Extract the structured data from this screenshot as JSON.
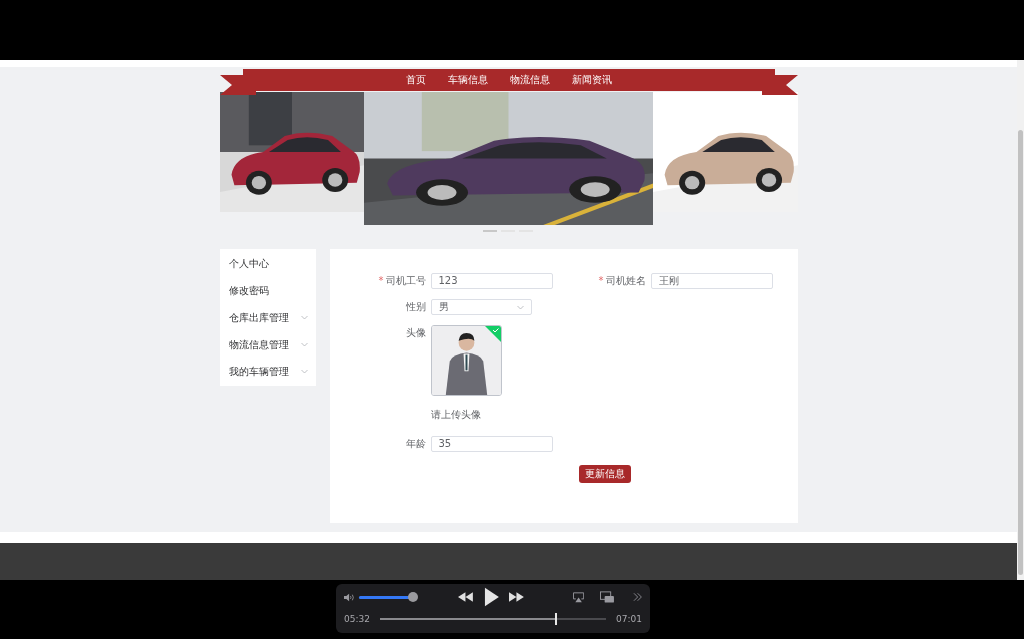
{
  "nav": {
    "items": [
      "首页",
      "车辆信息",
      "物流信息",
      "新闻资讯"
    ]
  },
  "carousel": {
    "indicators": [
      {
        "selected": true
      },
      {
        "selected": false
      },
      {
        "selected": false
      }
    ]
  },
  "sidebar": {
    "items": [
      {
        "label": "个人中心",
        "kind": "link",
        "expanded": false
      },
      {
        "label": "修改密码",
        "kind": "link",
        "expanded": false
      },
      {
        "label": "仓库出库管理",
        "kind": "submenu",
        "expanded": false
      },
      {
        "label": "物流信息管理",
        "kind": "submenu",
        "expanded": false
      },
      {
        "label": "我的车辆管理",
        "kind": "submenu",
        "expanded": false
      }
    ]
  },
  "form": {
    "fields": [
      {
        "kind": "text",
        "required_mark": "*",
        "label": "司机工号",
        "value": "123"
      },
      {
        "kind": "text",
        "required_mark": "*",
        "label": "司机姓名",
        "value": "王刚"
      },
      {
        "kind": "select",
        "label": "性别",
        "value": "男"
      },
      {
        "kind": "avatar",
        "label": "头像",
        "uploaded": true,
        "hint": "请上传头像"
      },
      {
        "kind": "text",
        "label": "年龄",
        "value": "35"
      }
    ],
    "submit": "更新信息"
  },
  "player": {
    "volume": {
      "level": 1
    },
    "current_time": "05:32",
    "duration": "07:01",
    "progress": {
      "level": 0.78
    }
  }
}
